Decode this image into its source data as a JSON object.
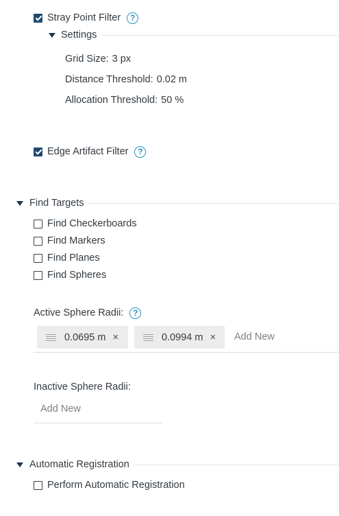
{
  "stray_filter": {
    "label": "Stray Point Filter",
    "checked": true,
    "help": "?",
    "settings": {
      "title": "Settings",
      "grid_label": "Grid Size:",
      "grid_value": "3 px",
      "distance_label": "Distance Threshold:",
      "distance_value": "0.02 m",
      "allocation_label": "Allocation Threshold:",
      "allocation_value": "50 %"
    }
  },
  "edge_filter": {
    "label": "Edge Artifact Filter",
    "checked": true,
    "help": "?"
  },
  "find_targets": {
    "title": "Find Targets",
    "options": [
      {
        "label": "Find Checkerboards",
        "checked": false
      },
      {
        "label": "Find Markers",
        "checked": false
      },
      {
        "label": "Find Planes",
        "checked": false
      },
      {
        "label": "Find Spheres",
        "checked": false
      }
    ],
    "active_radii": {
      "label": "Active Sphere Radii:",
      "help": "?",
      "chips": [
        "0.0695 m",
        "0.0994 m"
      ],
      "add_new": "Add New",
      "remove_glyph": "×"
    },
    "inactive_radii": {
      "label": "Inactive Sphere Radii:",
      "add_new": "Add New"
    }
  },
  "automatic_registration": {
    "title": "Automatic Registration",
    "option": {
      "label": "Perform Automatic Registration",
      "checked": false
    }
  },
  "colors": {
    "accent": "#2d8fc7",
    "checkbox_fill": "#1f4a6e",
    "chip_bg": "#ececec"
  }
}
